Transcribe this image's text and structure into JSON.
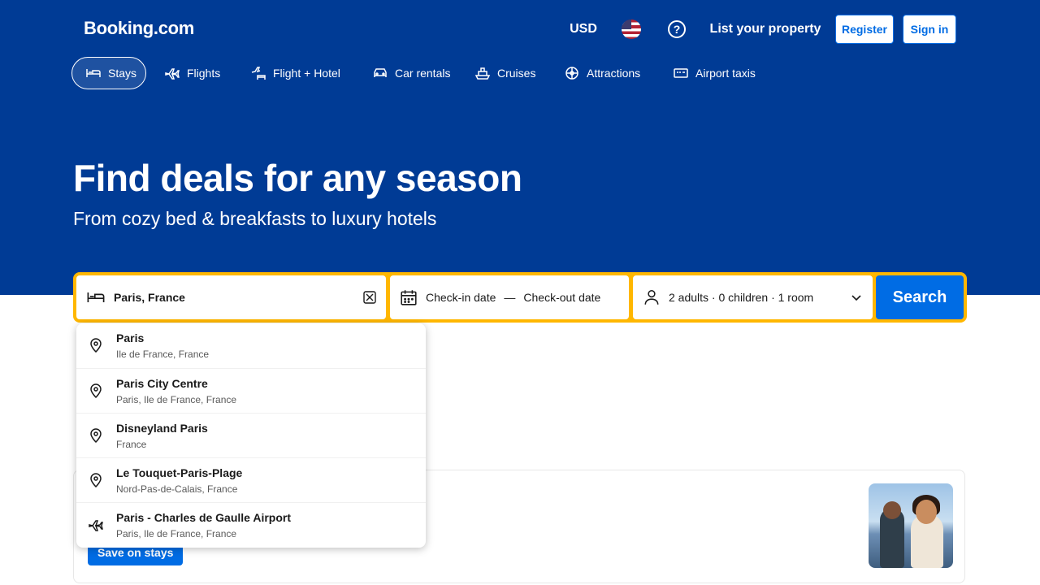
{
  "header": {
    "logo": "Booking.com",
    "currency": "USD",
    "flag_icon": "us-flag-icon",
    "help_icon": "question-circle-icon",
    "list_property": "List your property",
    "register": "Register",
    "sign_in": "Sign in"
  },
  "nav": {
    "items": [
      {
        "label": "Stays",
        "icon": "bed-icon"
      },
      {
        "label": "Flights",
        "icon": "plane-icon"
      },
      {
        "label": "Flight + Hotel",
        "icon": "plane-bed-icon"
      },
      {
        "label": "Car rentals",
        "icon": "car-icon"
      },
      {
        "label": "Cruises",
        "icon": "ship-icon"
      },
      {
        "label": "Attractions",
        "icon": "attractions-icon"
      },
      {
        "label": "Airport taxis",
        "icon": "taxi-icon"
      }
    ]
  },
  "hero": {
    "title": "Find deals for any season",
    "subtitle": "From cozy bed & breakfasts to luxury hotels"
  },
  "search": {
    "destination_value": "Paris, France",
    "checkin_placeholder": "Check-in date",
    "separator": "—",
    "checkout_placeholder": "Check-out date",
    "guests": "2 adults · 0 children · 1 room",
    "button": "Search"
  },
  "autocomplete": {
    "items": [
      {
        "name": "Paris",
        "region": "Ile de France, France"
      },
      {
        "name": "Paris City Centre",
        "region": "Paris, Ile de France, France"
      },
      {
        "name": "Disneyland Paris",
        "region": "France"
      },
      {
        "name": "Le Touquet-Paris-Plage",
        "region": "Nord-Pas-de-Calais, France"
      },
      {
        "name": "Paris - Charles de Gaulle Airport",
        "region": "Paris, Ile de France, France"
      }
    ]
  },
  "offers": {
    "save_button": "Save on stays"
  },
  "colors": {
    "brand_blue": "#003b95",
    "action_blue": "#006ce4",
    "search_yellow": "#ffb700"
  }
}
